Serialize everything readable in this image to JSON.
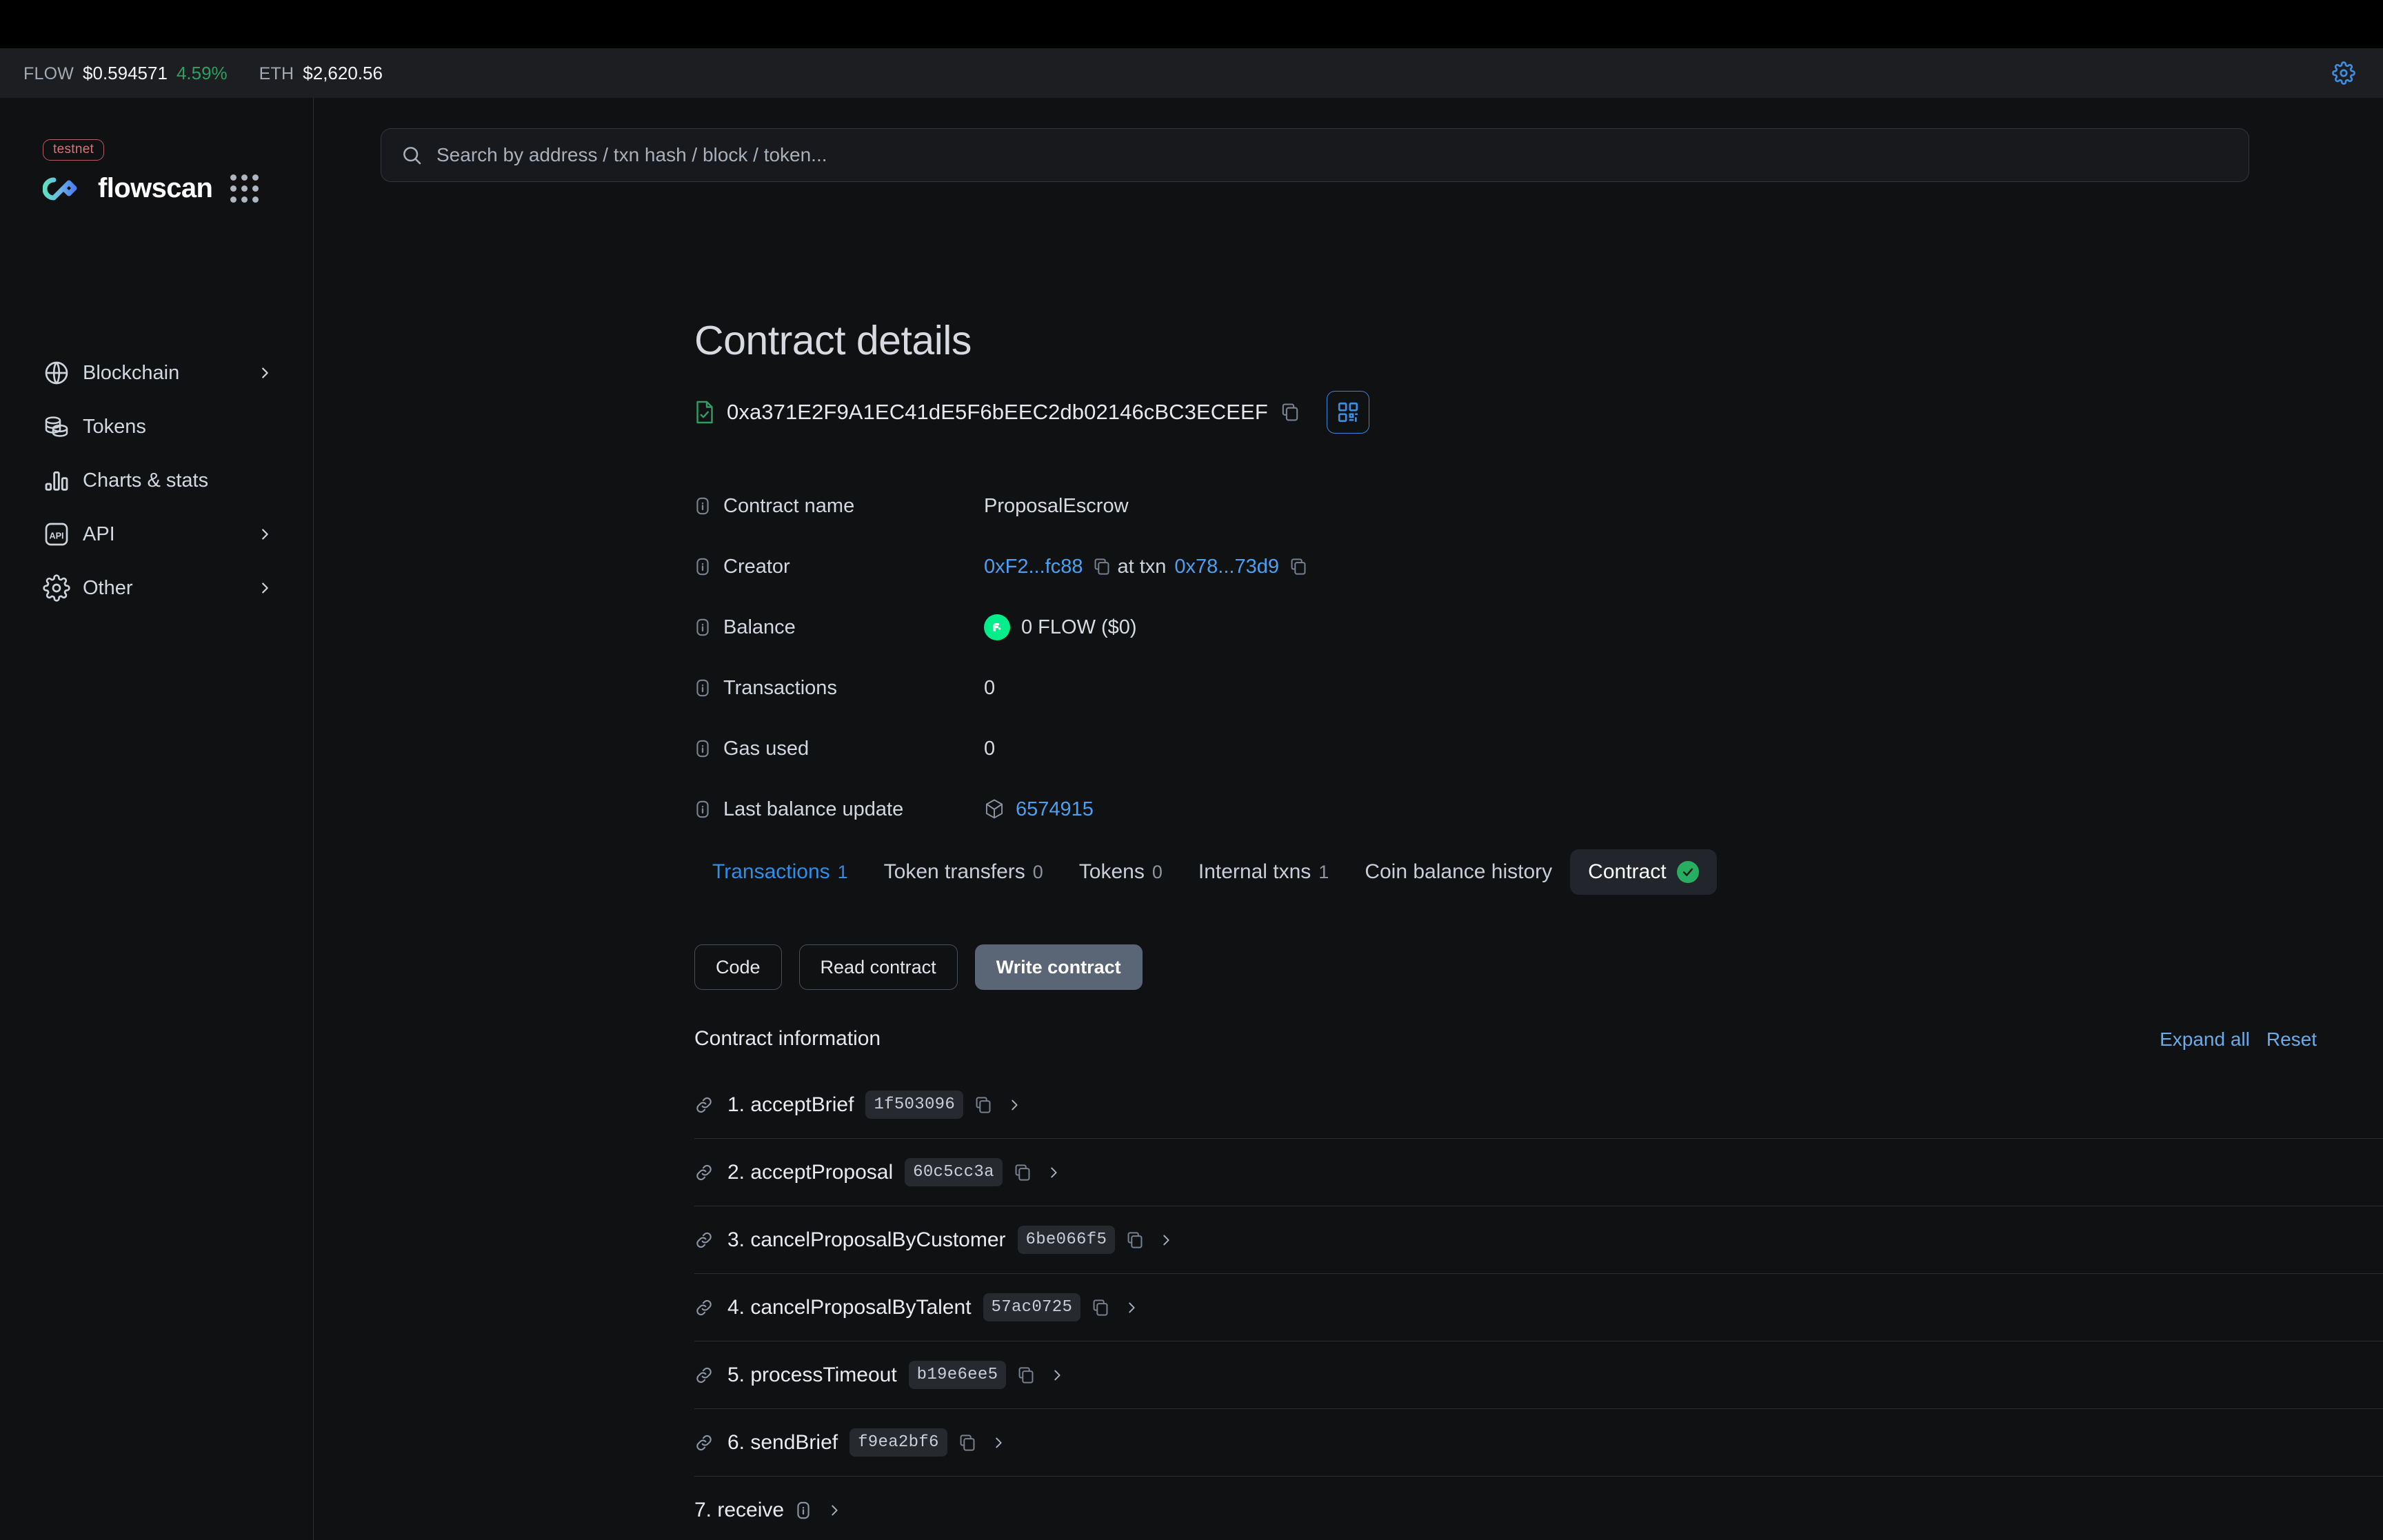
{
  "ticker": {
    "items": [
      {
        "label": "FLOW",
        "value": "$0.594571",
        "change": "4.59%"
      },
      {
        "label": "ETH",
        "value": "$2,620.56",
        "change": ""
      }
    ],
    "settings_icon": "gear-icon"
  },
  "sidebar": {
    "badge": "testnet",
    "brand": "flowscan",
    "apps_icon": "apps-grid-icon",
    "items": [
      {
        "label": "Blockchain",
        "icon": "globe-icon",
        "chevron": true
      },
      {
        "label": "Tokens",
        "icon": "coins-icon",
        "chevron": false
      },
      {
        "label": "Charts & stats",
        "icon": "bar-chart-icon",
        "chevron": false
      },
      {
        "label": "API",
        "icon": "api-icon",
        "chevron": true
      },
      {
        "label": "Other",
        "icon": "gear-icon",
        "chevron": true
      }
    ]
  },
  "search": {
    "placeholder": "Search by address / txn hash / block / token...",
    "value": "",
    "icon": "search-icon"
  },
  "page": {
    "title": "Contract details",
    "address": "0xa371E2F9A1EC41dE5F6bEEC2db02146cBC3ECEEF",
    "address_verified_icon": "verified-contract-file-icon",
    "copy_icon": "copy-icon",
    "qr_icon": "qr-code-icon"
  },
  "details": [
    {
      "label": "Contract name",
      "value": "ProposalEscrow",
      "type": "text"
    },
    {
      "label": "Creator",
      "value": "0xF2...fc88",
      "at_txn_label": "at txn",
      "txn": "0x78...73d9",
      "type": "creator"
    },
    {
      "label": "Balance",
      "value": "0 FLOW ($0)",
      "type": "balance"
    },
    {
      "label": "Transactions",
      "value": "0",
      "type": "text"
    },
    {
      "label": "Gas used",
      "value": "0",
      "type": "text"
    },
    {
      "label": "Last balance update",
      "value": "6574915",
      "type": "block"
    }
  ],
  "tabs": [
    {
      "label": "Transactions",
      "count": "1",
      "state": "active-text"
    },
    {
      "label": "Token transfers",
      "count": "0",
      "state": "normal"
    },
    {
      "label": "Tokens",
      "count": "0",
      "state": "normal"
    },
    {
      "label": "Internal txns",
      "count": "1",
      "state": "normal"
    },
    {
      "label": "Coin balance history",
      "count": "",
      "state": "normal"
    },
    {
      "label": "Contract",
      "count": "",
      "state": "pill",
      "verified": true
    }
  ],
  "subtabs": [
    {
      "label": "Code",
      "selected": false
    },
    {
      "label": "Read contract",
      "selected": false
    },
    {
      "label": "Write contract",
      "selected": true
    }
  ],
  "contract_information": {
    "heading": "Contract information",
    "expand_all": "Expand all",
    "reset": "Reset"
  },
  "methods": [
    {
      "name": "1. acceptBrief",
      "selector": "1f503096",
      "has_link_icon": true,
      "has_info_icon": false
    },
    {
      "name": "2. acceptProposal",
      "selector": "60c5cc3a",
      "has_link_icon": true,
      "has_info_icon": false
    },
    {
      "name": "3. cancelProposalByCustomer",
      "selector": "6be066f5",
      "has_link_icon": true,
      "has_info_icon": false
    },
    {
      "name": "4. cancelProposalByTalent",
      "selector": "57ac0725",
      "has_link_icon": true,
      "has_info_icon": false
    },
    {
      "name": "5. processTimeout",
      "selector": "b19e6ee5",
      "has_link_icon": true,
      "has_info_icon": false
    },
    {
      "name": "6. sendBrief",
      "selector": "f9ea2bf6",
      "has_link_icon": true,
      "has_info_icon": false
    },
    {
      "name": "7. receive",
      "selector": "",
      "has_link_icon": false,
      "has_info_icon": true
    }
  ],
  "colors": {
    "background": "#101113",
    "black": "#000000",
    "ticker_bg": "#1c1e21",
    "accent_link": "#4d9ff0",
    "accent_blue": "#2f8fe8",
    "positive": "#2f9e63",
    "flow_green": "#00ef8b",
    "verified_green": "#27ae60",
    "testnet_red": "#d9737a",
    "pill_bg": "#22262c",
    "selected_btn": "#5a6575"
  }
}
